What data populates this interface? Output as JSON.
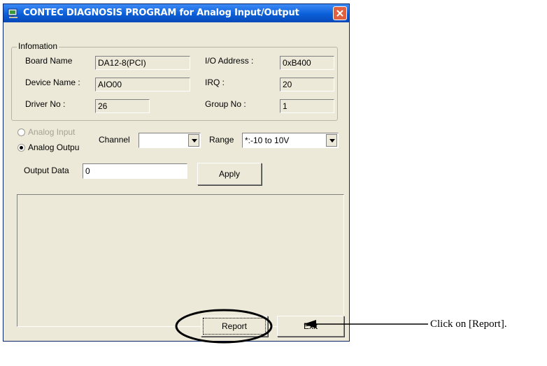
{
  "window": {
    "title": "CONTEC DIAGNOSIS PROGRAM for Analog Input/Output"
  },
  "info": {
    "legend": "Infomation",
    "board_name_label": "Board Name",
    "board_name_value": "DA12-8(PCI)",
    "io_address_label": "I/O Address :",
    "io_address_value": "0xB400",
    "device_name_label": "Device Name :",
    "device_name_value": "AIO00",
    "irq_label": "IRQ :",
    "irq_value": "20",
    "driver_no_label": "Driver No :",
    "driver_no_value": "26",
    "group_no_label": "Group No :",
    "group_no_value": "1"
  },
  "mode": {
    "analog_input_label": "Analog Input",
    "analog_output_label": "Analog Outpu",
    "selected": "Analog Output"
  },
  "channel": {
    "label": "Channel",
    "value": ""
  },
  "range": {
    "label": "Range",
    "value": "*:-10 to 10V"
  },
  "output": {
    "label": "Output Data",
    "value": "0"
  },
  "buttons": {
    "apply": "Apply",
    "report": "Report",
    "exit": "Exit"
  },
  "annotation": {
    "text": "Click on [Report]."
  },
  "icons": {
    "app": "app-icon",
    "close": "close-icon",
    "dropdown": "chevron-down-icon"
  },
  "colors": {
    "titlebar": "#0a5fd8",
    "window_bg": "#ece9d8",
    "close_button": "#e0603f"
  }
}
